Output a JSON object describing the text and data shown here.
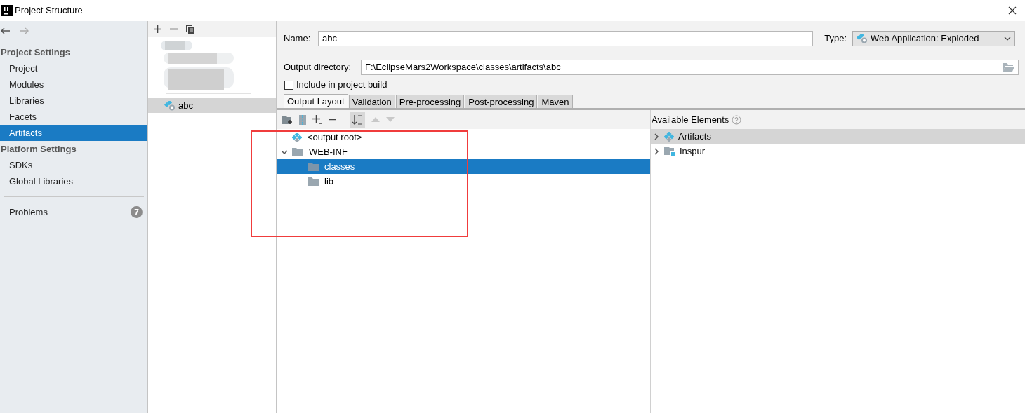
{
  "window": {
    "title": "Project Structure"
  },
  "sidebar": {
    "sections": [
      {
        "title": "Project Settings",
        "items": [
          {
            "label": "Project",
            "selected": false
          },
          {
            "label": "Modules",
            "selected": false
          },
          {
            "label": "Libraries",
            "selected": false
          },
          {
            "label": "Facets",
            "selected": false
          },
          {
            "label": "Artifacts",
            "selected": true
          }
        ]
      },
      {
        "title": "Platform Settings",
        "items": [
          {
            "label": "SDKs",
            "selected": false
          },
          {
            "label": "Global Libraries",
            "selected": false
          }
        ]
      }
    ],
    "problems": {
      "label": "Problems",
      "count": "7"
    }
  },
  "artifact_list": {
    "items": [
      {
        "label": "abc",
        "selected": true
      }
    ]
  },
  "form": {
    "name_label": "Name:",
    "name_value": "abc",
    "type_label": "Type:",
    "type_value": "Web Application: Exploded",
    "output_label": "Output directory:",
    "output_value": "F:\\EclipseMars2Workspace\\classes\\artifacts\\abc",
    "include_label": "Include in project build",
    "include_checked": false
  },
  "tabs": [
    {
      "label": "Output Layout",
      "selected": true
    },
    {
      "label": "Validation",
      "selected": false
    },
    {
      "label": "Pre-processing",
      "selected": false
    },
    {
      "label": "Post-processing",
      "selected": false
    },
    {
      "label": "Maven",
      "selected": false
    }
  ],
  "output_tree": [
    {
      "label": "<output root>",
      "kind": "root",
      "selected": false
    },
    {
      "label": "WEB-INF",
      "kind": "folder",
      "selected": false,
      "expanded": true,
      "children": [
        {
          "label": "classes",
          "kind": "folder",
          "selected": true
        },
        {
          "label": "lib",
          "kind": "folder",
          "selected": false
        }
      ]
    }
  ],
  "available": {
    "title": "Available Elements",
    "items": [
      {
        "label": "Artifacts",
        "kind": "artifacts",
        "selected": true,
        "expanded": false
      },
      {
        "label": "Inspur",
        "kind": "module",
        "selected": false,
        "expanded": false
      }
    ]
  }
}
